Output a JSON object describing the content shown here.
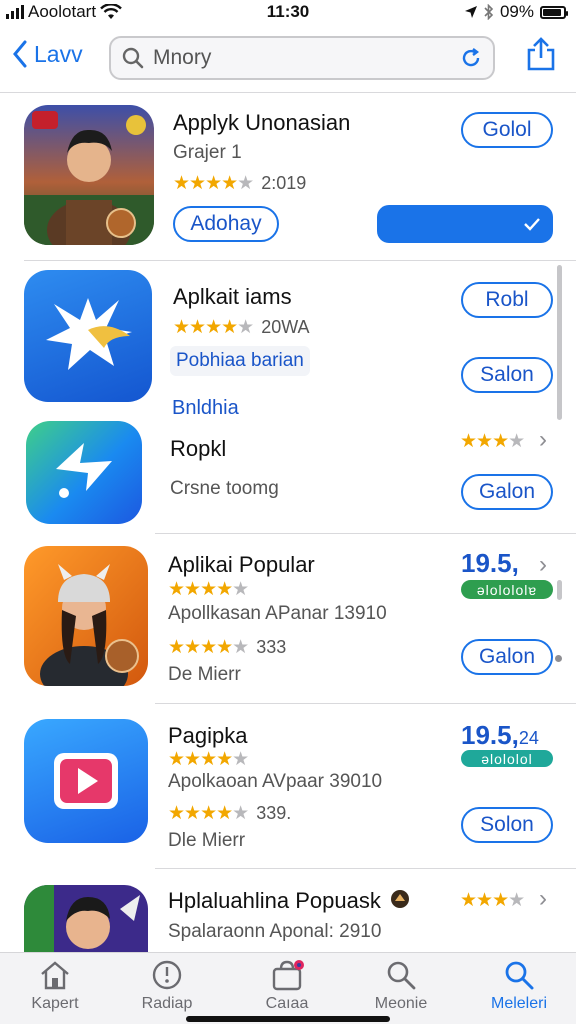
{
  "status": {
    "carrier": "Aoolotart",
    "time": "11:30",
    "battery": "09%",
    "battery_level": 0.9
  },
  "nav": {
    "back_label": "Lavv",
    "search_value": "Mnory"
  },
  "apps": [
    {
      "name": "Applyk Unonasian",
      "subtitle": "Grajer 1",
      "stars": 3.5,
      "rating_count": "2:019",
      "button1": "Golol",
      "button2": "Adohay"
    },
    {
      "name": "Aplkait iams",
      "stars": 4,
      "rating_count": "20WA",
      "badge_text": "Pobhiaa barian",
      "link": "Bnldhia",
      "button1": "Robl",
      "button2": "Salon"
    },
    {
      "name": "Ropkl",
      "subtitle": "Crsne toomg",
      "stars": 3.5,
      "button": "Galon"
    },
    {
      "name": "Aplikai Popular",
      "stars": 4,
      "subtitle": "Apollkasan APanar 13910",
      "stars2": 3.5,
      "rating_count": "333",
      "subtitle2": "De Mierr",
      "price": "19.5,",
      "tag": "ǝlolololɐ",
      "button": "Galon"
    },
    {
      "name": "Pagipka",
      "stars": 4,
      "subtitle": "Apolkaoan AVpaar 39010",
      "stars2": 3.5,
      "rating_count": "339.",
      "subtitle2": "Dle Mierr",
      "price": "19.5,",
      "price_suffix": "24",
      "tag": "ǝlololol",
      "button": "Solon"
    },
    {
      "name": "Hplaluahlina Popuask",
      "subtitle": "Spalaraonn Aponal: 2910",
      "stars": 3.5
    }
  ],
  "tabs": [
    {
      "label": "Kapert",
      "icon": "home-icon"
    },
    {
      "label": "Radiap",
      "icon": "clock-icon"
    },
    {
      "label": "Caıaa",
      "icon": "bag-icon"
    },
    {
      "label": "Meonie",
      "icon": "search-icon"
    },
    {
      "label": "Meleleri",
      "icon": "search-icon",
      "active": true
    }
  ],
  "colors": {
    "accent": "#1a73e8",
    "star": "#f2a700",
    "green_tag": "#2e9e4f",
    "teal_tag": "#1fa89a"
  }
}
